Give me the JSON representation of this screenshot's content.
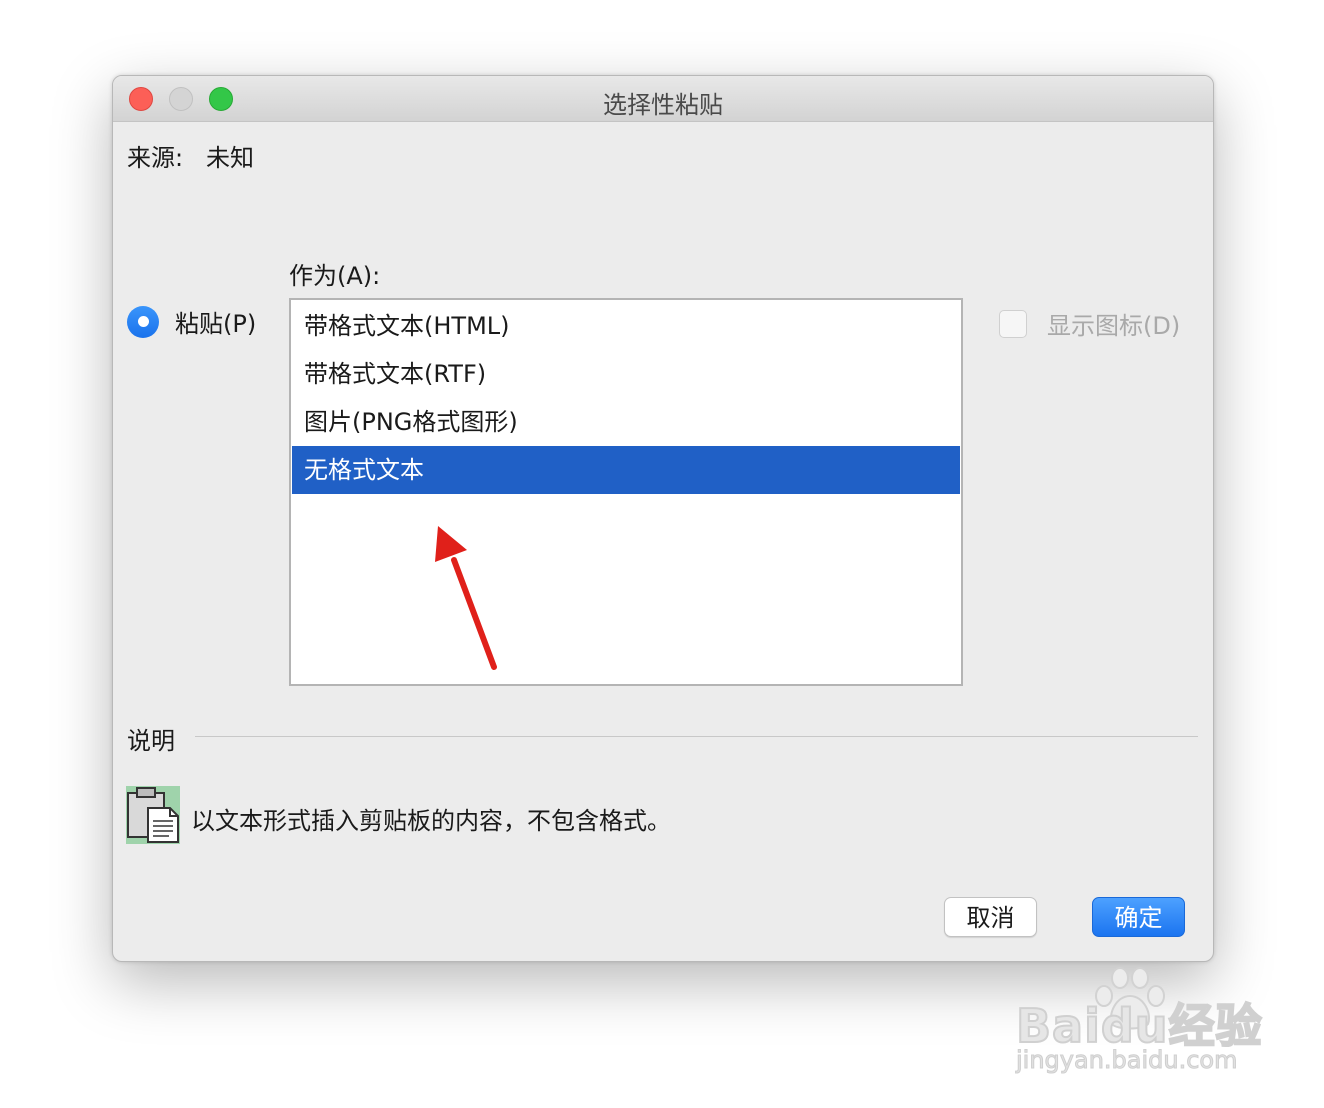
{
  "window": {
    "title": "选择性粘贴"
  },
  "source": {
    "label": "来源:",
    "value": "未知"
  },
  "as_label": "作为(A):",
  "paste_option": {
    "label": "粘贴(P)",
    "selected": true
  },
  "format_list": {
    "items": [
      "带格式文本(HTML)",
      "带格式文本(RTF)",
      "图片(PNG格式图形)",
      "无格式文本"
    ],
    "selected": "无格式文本"
  },
  "show_icon": {
    "label": "显示图标(D)",
    "checked": false,
    "enabled": false
  },
  "description": {
    "label": "说明",
    "text": "以文本形式插入剪贴板的内容，不包含格式。"
  },
  "buttons": {
    "cancel": "取消",
    "ok": "确定"
  },
  "watermark": {
    "brand_a": "Bai",
    "brand_b": "du",
    "brand_c": "经验",
    "url": "jingyan.baidu.com"
  },
  "colors": {
    "accent": "#1b74f0",
    "selection": "#2060c6",
    "annotation_arrow": "#e0201a"
  },
  "icons": [
    "close-icon",
    "minimize-icon",
    "maximize-icon",
    "clipboard-icon",
    "arrow-annotation",
    "paw-icon"
  ]
}
